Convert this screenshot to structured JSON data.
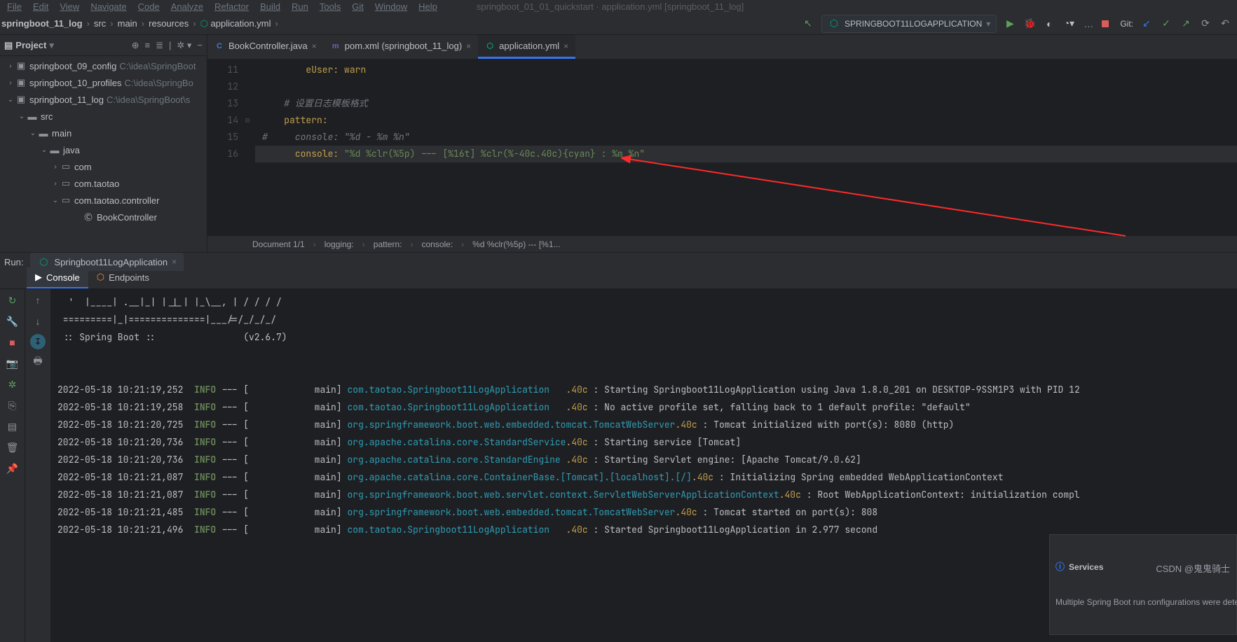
{
  "menu": {
    "items": [
      "File",
      "Edit",
      "View",
      "Navigate",
      "Code",
      "Analyze",
      "Refactor",
      "Build",
      "Run",
      "Tools",
      "Git",
      "Window",
      "Help"
    ],
    "rightDim": "springboot_01_01_quickstart · application.yml [springboot_11_log]"
  },
  "breadcrumb": {
    "items": [
      "springboot_11_log",
      "src",
      "main",
      "resources",
      "application.yml"
    ],
    "lastBold": true
  },
  "runConfig": {
    "name": "SPRINGBOOT11LOGAPPLICATION"
  },
  "gitLabel": "Git:",
  "sidebar": {
    "title": "Project",
    "tree": [
      {
        "ind": 1,
        "tw": "›",
        "ic": "mod",
        "name": "springboot_09_config",
        "dim": "C:\\idea\\SpringBoot"
      },
      {
        "ind": 1,
        "tw": "›",
        "ic": "mod",
        "name": "springboot_10_profiles",
        "dim": "C:\\idea\\SpringBo"
      },
      {
        "ind": 1,
        "tw": "⌄",
        "ic": "mod",
        "name": "springboot_11_log",
        "dim": "C:\\idea\\SpringBoot\\s"
      },
      {
        "ind": 2,
        "tw": "⌄",
        "ic": "folder",
        "name": "src"
      },
      {
        "ind": 3,
        "tw": "⌄",
        "ic": "folder",
        "name": "main"
      },
      {
        "ind": 4,
        "tw": "⌄",
        "ic": "folder",
        "name": "java"
      },
      {
        "ind": 5,
        "tw": "›",
        "ic": "pkg",
        "name": "com"
      },
      {
        "ind": 5,
        "tw": "›",
        "ic": "pkg",
        "name": "com.taotao"
      },
      {
        "ind": 5,
        "tw": "⌄",
        "ic": "pkg",
        "name": "com.taotao.controller"
      },
      {
        "ind": 7,
        "tw": "",
        "ic": "class",
        "name": "BookController"
      }
    ]
  },
  "tabs": [
    {
      "label": "BookController.java",
      "ic": "C",
      "cls": "ic-c",
      "active": false
    },
    {
      "label": "pom.xml (springboot_11_log)",
      "ic": "m",
      "cls": "ic-m",
      "active": false
    },
    {
      "label": "application.yml",
      "ic": "",
      "cls": "ic-y",
      "active": true
    }
  ],
  "gutterStart": 11,
  "code": {
    "lines": [
      {
        "n": 11,
        "html": "        <span class='k-key'>eUser</span><span class='k-key'>:</span> <span class='k-val'>warn</span>"
      },
      {
        "n": 12,
        "html": ""
      },
      {
        "n": 13,
        "html": "    <span class='k-com'># 设置日志模板格式</span>"
      },
      {
        "n": 14,
        "html": "    <span class='k-key'>pattern</span><span class='k-key'>:</span>"
      },
      {
        "n": 15,
        "html": "<span class='k-com'>#     console: \"%d - %m %n\"</span>"
      },
      {
        "n": 16,
        "hl": true,
        "html": "      <span class='k-key'>console</span><span class='k-key'>:</span> <span class='k-str'>\"%d %clr(%5p) --- [%16t] %clr(%-40c.40c){cyan} : %m %n\"</span>"
      }
    ]
  },
  "editorStatus": {
    "doc": "Document 1/1",
    "path": [
      "logging:",
      "pattern:",
      "console:",
      "%d %clr(%5p) --- [%1..."
    ]
  },
  "run": {
    "label": "Run:",
    "tab": "Springboot11LogApplication",
    "innerTabs": [
      {
        "label": "Console",
        "active": true
      },
      {
        "label": "Endpoints",
        "active": false
      }
    ],
    "banner": [
      "  '  |____| .__|_| |_|_| |_\\__, | / / / /",
      " =========|_|==============|___/=/_/_/_/",
      " :: Spring Boot ::                (v2.6.7)",
      ""
    ],
    "logs": [
      {
        "ts": "2022-05-18 10:21:19,252",
        "lvl": "INFO",
        "thread": "main",
        "cls": "com.taotao.Springboot11LogApplication   ",
        "suf": ".40c",
        "msg": "Starting Springboot11LogApplication using Java 1.8.0_201 on DESKTOP-9SSM1P3 with PID 12"
      },
      {
        "ts": "2022-05-18 10:21:19,258",
        "lvl": "INFO",
        "thread": "main",
        "cls": "com.taotao.Springboot11LogApplication   ",
        "suf": ".40c",
        "msg": "No active profile set, falling back to 1 default profile: \"default\""
      },
      {
        "ts": "2022-05-18 10:21:20,725",
        "lvl": "INFO",
        "thread": "main",
        "cls": "org.springframework.boot.web.embedded.tomcat.TomcatWebServer",
        "suf": ".40c",
        "msg": "Tomcat initialized with port(s): 8080 (http)"
      },
      {
        "ts": "2022-05-18 10:21:20,736",
        "lvl": "INFO",
        "thread": "main",
        "cls": "org.apache.catalina.core.StandardService",
        "suf": ".40c",
        "msg": "Starting service [Tomcat]"
      },
      {
        "ts": "2022-05-18 10:21:20,736",
        "lvl": "INFO",
        "thread": "main",
        "cls": "org.apache.catalina.core.StandardEngine ",
        "suf": ".40c",
        "msg": "Starting Servlet engine: [Apache Tomcat/9.0.62]"
      },
      {
        "ts": "2022-05-18 10:21:21,087",
        "lvl": "INFO",
        "thread": "main",
        "cls": "org.apache.catalina.core.ContainerBase.[Tomcat].[localhost].[/]",
        "suf": ".40c",
        "msg": "Initializing Spring embedded WebApplicationContext"
      },
      {
        "ts": "2022-05-18 10:21:21,087",
        "lvl": "INFO",
        "thread": "main",
        "cls": "org.springframework.boot.web.servlet.context.ServletWebServerApplicationContext",
        "suf": ".40c",
        "msg": "Root WebApplicationContext: initialization compl"
      },
      {
        "ts": "2022-05-18 10:21:21,485",
        "lvl": "INFO",
        "thread": "main",
        "cls": "org.springframework.boot.web.embedded.tomcat.TomcatWebServer",
        "suf": ".40c",
        "msg": "Tomcat started on port(s): 808"
      },
      {
        "ts": "2022-05-18 10:21:21,496",
        "lvl": "INFO",
        "thread": "main",
        "cls": "com.taotao.Springboot11LogApplication   ",
        "suf": ".40c",
        "msg": "Started Springboot11LogApplication in 2.977 second"
      }
    ]
  },
  "services": {
    "title": "Services",
    "msg": "Multiple Spring Boot run configurations were detected...."
  },
  "watermark": "CSDN @鬼鬼骑士"
}
